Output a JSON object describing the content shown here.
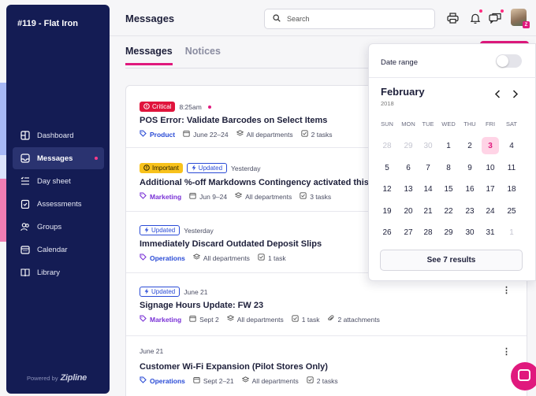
{
  "sidebar": {
    "store_name": "#119 - Flat Iron",
    "items": [
      {
        "label": "Dashboard",
        "icon": "dashboard-icon"
      },
      {
        "label": "Messages",
        "icon": "messages-icon",
        "active": true
      },
      {
        "label": "Day sheet",
        "icon": "day-sheet-icon"
      },
      {
        "label": "Assessments",
        "icon": "assessments-icon"
      },
      {
        "label": "Groups",
        "icon": "groups-icon"
      },
      {
        "label": "Calendar",
        "icon": "calendar-icon"
      },
      {
        "label": "Library",
        "icon": "library-icon"
      }
    ],
    "powered_by": "Powered by",
    "brand": "Zipline"
  },
  "header": {
    "title": "Messages",
    "search_placeholder": "Search"
  },
  "tabs": [
    {
      "label": "Messages",
      "active": true
    },
    {
      "label": "Notices",
      "active": false
    }
  ],
  "messages": [
    {
      "badges": [
        {
          "type": "critical",
          "label": "Critical"
        }
      ],
      "time": "8:25am",
      "title": "POS Error: Validate Barcodes on Select Items",
      "category": "Product",
      "dates": "June 22–24",
      "departments": "All departments",
      "tasks": "2 tasks"
    },
    {
      "badges": [
        {
          "type": "important",
          "label": "Important"
        },
        {
          "type": "updated",
          "label": "Updated"
        }
      ],
      "time": "Yesterday",
      "title": "Additional %-off Markdowns Contingency activated this F",
      "category": "Marketing",
      "dates": "Jun 9–24",
      "departments": "All departments",
      "tasks": "3 tasks"
    },
    {
      "badges": [
        {
          "type": "updated",
          "label": "Updated"
        }
      ],
      "time": "Yesterday",
      "title": "Immediately Discard Outdated Deposit Slips",
      "category": "Operations",
      "departments": "All departments",
      "tasks": "1 task"
    },
    {
      "badges": [
        {
          "type": "updated",
          "label": "Updated"
        }
      ],
      "time": "June 21",
      "title": "Signage Hours Update: FW 23",
      "category": "Marketing",
      "dates": "Sept 2",
      "departments": "All departments",
      "tasks": "1 task",
      "attachments": "2 attachments"
    },
    {
      "time": "June 21",
      "title": "Customer Wi-Fi Expansion (Pilot Stores Only)",
      "category": "Operations",
      "dates": "Sept 2–21",
      "departments": "All departments",
      "tasks": "2 tasks"
    }
  ],
  "date_range": {
    "label": "Date range",
    "toggle_on": false,
    "month": "February",
    "year": "2018",
    "weekdays": [
      "SUN",
      "MON",
      "TUE",
      "WED",
      "THU",
      "FRI",
      "SAT"
    ],
    "weeks": [
      [
        "28",
        "29",
        "30",
        "1",
        "2",
        "3",
        "4"
      ],
      [
        "5",
        "6",
        "7",
        "8",
        "9",
        "10",
        "11"
      ],
      [
        "12",
        "13",
        "14",
        "15",
        "16",
        "17",
        "18"
      ],
      [
        "19",
        "20",
        "21",
        "22",
        "23",
        "24",
        "25"
      ],
      [
        "26",
        "27",
        "28",
        "29",
        "30",
        "31",
        "1"
      ]
    ],
    "today": "3",
    "button_label": "See 7 results"
  },
  "colors": {
    "sidebar": "#141c54",
    "accent": "#e0197d",
    "critical": "#e0143c",
    "important": "#f8c21c",
    "updated": "#2a4bd6",
    "marketing": "#7a32d6"
  }
}
